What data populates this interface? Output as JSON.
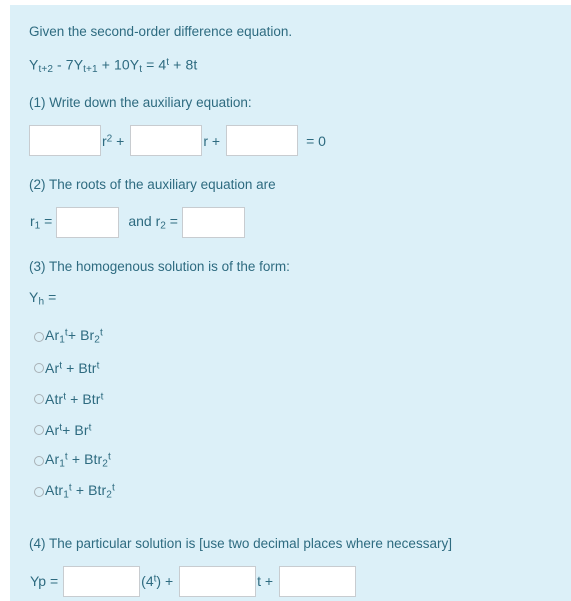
{
  "question": {
    "intro": "Given the second-order difference equation.",
    "equation": {
      "y1": "Y",
      "y1_sub": "t+2",
      "minus": " - 7",
      "y2": "Y",
      "y2_sub": "t+1",
      "plus": " + 10",
      "y3": "Y",
      "y3_sub": "t",
      "equals": " = 4",
      "exp": "t",
      "tail": " + 8t"
    },
    "part1": {
      "prompt": "(1) Write down the auxiliary equation:",
      "fields": [
        {
          "name": "aux-coefficient-r2",
          "value": "",
          "placeholder": ""
        },
        {
          "name": "aux-coefficient-r",
          "value": "",
          "placeholder": ""
        },
        {
          "name": "aux-constant",
          "value": "",
          "placeholder": ""
        }
      ],
      "label_r2": "r",
      "label_r2_sup": "2",
      "label_r2_plus": " +",
      "label_r": "r +",
      "label_eq0": "= 0"
    },
    "part2": {
      "prompt": "(2) The roots of the auxiliary equation are",
      "label_r1": "r",
      "label_r1_sub": "1",
      "label_r1_eq": " =",
      "label_and": "and r",
      "label_r2_sub": "2",
      "label_r2_eq": " =",
      "fields": [
        {
          "name": "root-1",
          "value": "",
          "placeholder": ""
        },
        {
          "name": "root-2",
          "value": "",
          "placeholder": ""
        }
      ]
    },
    "part3": {
      "prompt": "(3) The homogenous solution is of the form:",
      "label_yh": "Y",
      "label_yh_sub": "h",
      "label_yh_eq": " =",
      "options": [
        {
          "id": "opt-1",
          "text": "Ar₁ᵗ+ Br₂ᵗ",
          "html": "Ar<sub>1</sub><sup>t</sup>+ Br<sub>2</sub><sup>t</sup>"
        },
        {
          "id": "opt-2",
          "text": "Arᵗ + Btrᵗ",
          "html": "Ar<sup>t</sup> + Btr<sup>t</sup>"
        },
        {
          "id": "opt-3",
          "text": "Atrᵗ + Btrᵗ",
          "html": "Atr<sup>t</sup> + Btr<sup>t</sup>"
        },
        {
          "id": "opt-4",
          "text": "Arᵗ+ Brᵗ",
          "html": "Ar<sup>t</sup>+ Br<sup>t</sup>"
        },
        {
          "id": "opt-5",
          "text": "Ar₁ᵗ + Btr₂ᵗ",
          "html": "Ar<sub>1</sub><sup>t</sup> + Btr<sub>2</sub><sup>t</sup>"
        },
        {
          "id": "opt-6",
          "text": "Atr₁ᵗ + Btr₂ᵗ",
          "html": "Atr<sub>1</sub><sup>t</sup> + Btr<sub>2</sub><sup>t</sup>"
        }
      ],
      "selected": null
    },
    "part4": {
      "prompt": "(4) The particular solution is [use two decimal places where necessary]",
      "label_yp": "Yp =",
      "label_4t": "(4",
      "label_4t_sup": "t",
      "label_4t_close": ") +",
      "label_t_plus": "t +",
      "fields": [
        {
          "name": "particular-coefficient-4t",
          "value": "",
          "placeholder": ""
        },
        {
          "name": "particular-coefficient-t",
          "value": "",
          "placeholder": ""
        },
        {
          "name": "particular-constant",
          "value": "",
          "placeholder": ""
        }
      ]
    }
  },
  "colors": {
    "panel_background": "#dcf0f8",
    "text": "#2e6b80",
    "field_border": "#c8ccd0",
    "field_background": "#ffffff",
    "page_background": "#ffffff"
  }
}
